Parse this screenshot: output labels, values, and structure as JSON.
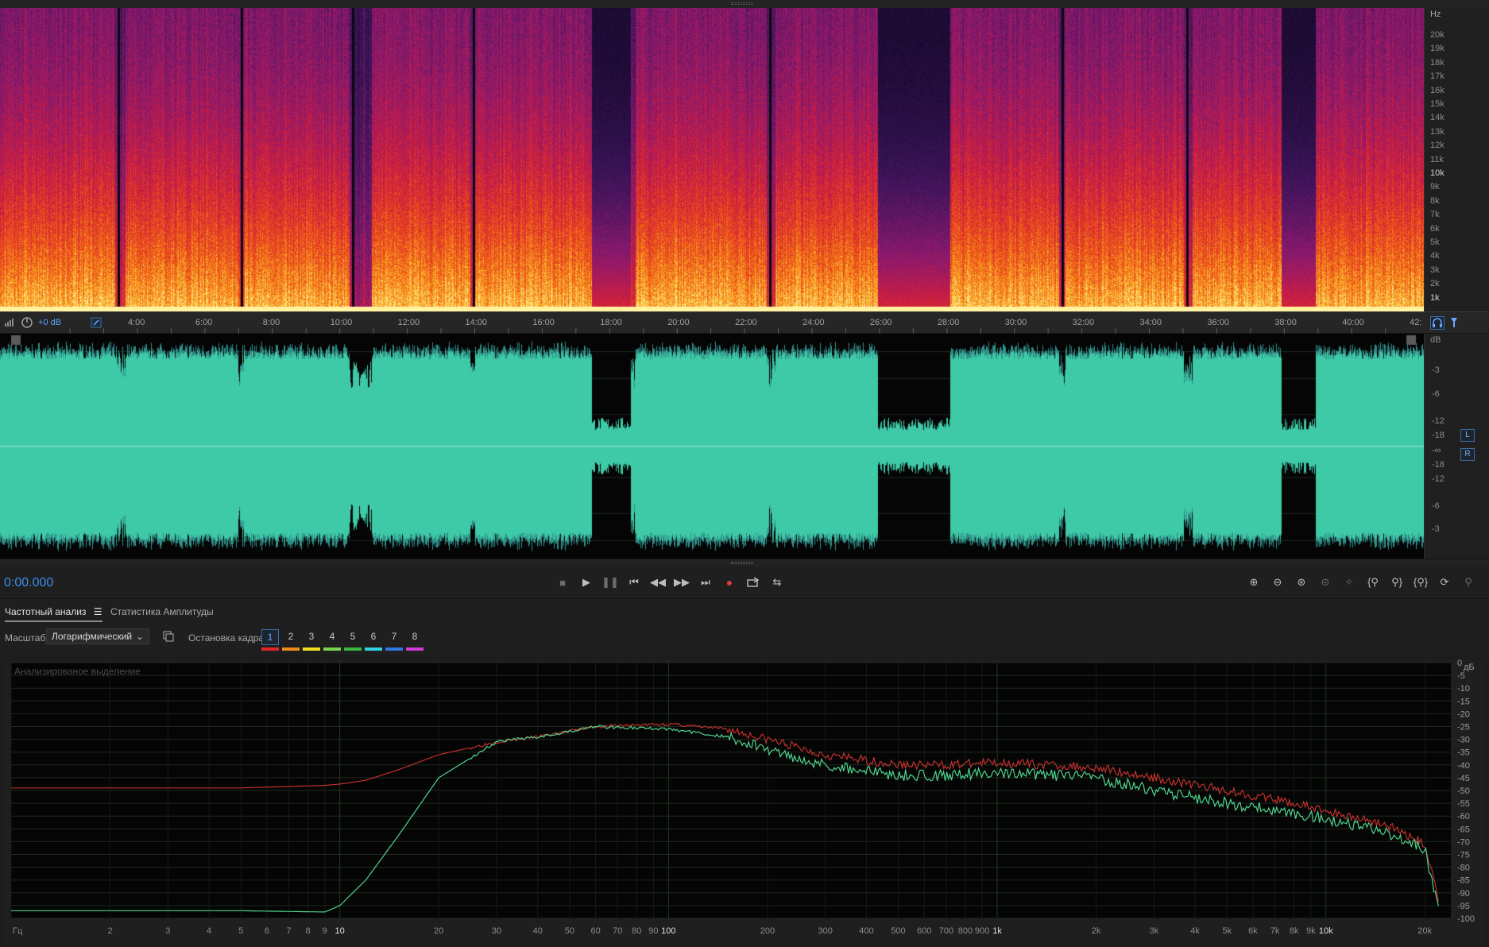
{
  "spectrogram": {
    "hz_unit": "Hz",
    "hz_labels": [
      "20k",
      "19k",
      "18k",
      "17k",
      "16k",
      "15k",
      "14k",
      "13k",
      "12k",
      "11k",
      "10k",
      "9k",
      "8k",
      "7k",
      "6k",
      "5k",
      "4k",
      "3k",
      "2k",
      "1k"
    ]
  },
  "timeline": {
    "gain_label": "+0 dB",
    "ticks": [
      "4:00",
      "6:00",
      "8:00",
      "10:00",
      "12:00",
      "14:00",
      "16:00",
      "18:00",
      "20:00",
      "22:00",
      "24:00",
      "26:00",
      "28:00",
      "30:00",
      "32:00",
      "34:00",
      "36:00",
      "38:00",
      "40:00",
      "42:"
    ]
  },
  "waveform": {
    "db_unit": "dB",
    "db_labels": [
      "-3",
      "-6",
      "-12",
      "-18",
      "-∞",
      "-18",
      "-12",
      "-6",
      "-3"
    ],
    "channels": [
      "L",
      "R"
    ]
  },
  "transport": {
    "time": "0:00.000",
    "icons": [
      "stop-icon",
      "play-icon",
      "pause-icon",
      "skip-to-start-icon",
      "rewind-icon",
      "fast-forward-icon",
      "skip-to-end-icon",
      "record-icon",
      "loop-icon",
      "skip-selection-icon"
    ],
    "zoom_icons": [
      "zoom-in-amplitude-icon",
      "zoom-out-amplitude-icon",
      "zoom-in-time-icon",
      "zoom-out-time-icon",
      "zoom-reset-icon",
      "zoom-in-at-start-icon",
      "zoom-in-at-end-icon",
      "zoom-out-full-icon",
      "zoom-selection-icon",
      "zoom-to-playhead-icon",
      "zoom-disabled-icon"
    ]
  },
  "panel": {
    "tab_frequency": "Частотный анализ",
    "tab_amplitude": "Статистика Амплитуды",
    "scale_label": "Масштаб:",
    "scale_value": "Логарифмический",
    "frame_hold_label": "Остановка кадра:",
    "frames": [
      "1",
      "2",
      "3",
      "4",
      "5",
      "6",
      "7",
      "8"
    ],
    "frame_colors": [
      "#e0262c",
      "#f08a1a",
      "#f0e020",
      "#7ad34a",
      "#3ab843",
      "#2fd0e0",
      "#2f78e0",
      "#d33ad3"
    ],
    "overlay": "Анализированое выделение"
  },
  "chart_data": {
    "type": "line",
    "title": "",
    "xlabel": "Гц",
    "ylabel": "дБ",
    "xscale": "log",
    "xlim": [
      1,
      24000
    ],
    "ylim": [
      -100,
      0
    ],
    "x_ticks": [
      "Гц",
      "2",
      "3",
      "4",
      "5",
      "6",
      "7",
      "8",
      "9",
      "10",
      "20",
      "30",
      "40",
      "50",
      "60",
      "70",
      "80",
      "90",
      "100",
      "200",
      "300",
      "400",
      "500",
      "600",
      "700",
      "800",
      "900",
      "1k",
      "2k",
      "3k",
      "4k",
      "5k",
      "6k",
      "7k",
      "8k",
      "9k",
      "10k",
      "20k"
    ],
    "y_ticks": [
      "0",
      "-5",
      "-10",
      "-15",
      "-20",
      "-25",
      "-30",
      "-35",
      "-40",
      "-45",
      "-50",
      "-55",
      "-60",
      "-65",
      "-70",
      "-75",
      "-80",
      "-85",
      "-90",
      "-95",
      "-100"
    ],
    "series": [
      {
        "color": "#c0312d",
        "x": [
          1,
          5,
          9,
          10,
          12,
          15,
          20,
          30,
          40,
          60,
          100,
          150,
          200,
          300,
          500,
          700,
          1000,
          2000,
          3000,
          5000,
          8000,
          10000,
          15000,
          20000,
          22000
        ],
        "y": [
          -49,
          -49,
          -48,
          -47.5,
          -46,
          -42,
          -36,
          -31,
          -29,
          -25,
          -24,
          -26,
          -30,
          -36,
          -40,
          -40,
          -39,
          -41,
          -45,
          -50,
          -55,
          -58,
          -63,
          -71,
          -92
        ]
      },
      {
        "color": "#4fd48e",
        "x": [
          1,
          5,
          9,
          10,
          12,
          15,
          20,
          30,
          40,
          60,
          100,
          150,
          200,
          300,
          500,
          700,
          1000,
          2000,
          3000,
          5000,
          8000,
          10000,
          15000,
          20000,
          22000
        ],
        "y": [
          -97,
          -97,
          -97.5,
          -95,
          -85,
          -68,
          -45,
          -31,
          -29,
          -25,
          -26,
          -29,
          -34,
          -40,
          -44,
          -44,
          -43,
          -45,
          -50,
          -55,
          -59,
          -61,
          -66,
          -73,
          -96
        ]
      }
    ]
  }
}
